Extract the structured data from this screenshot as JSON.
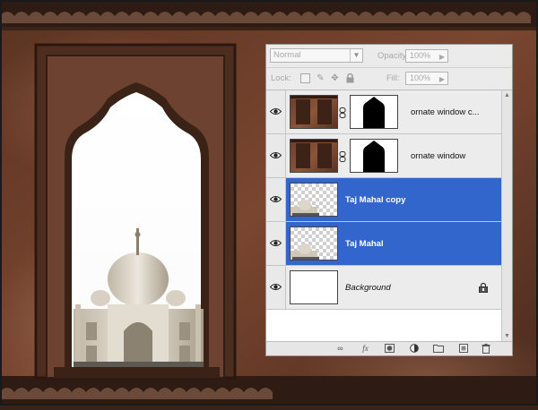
{
  "layers_panel": {
    "blend_mode": "Normal",
    "opacity_label": "Opacity:",
    "opacity_value": "100%",
    "lock_label": "Lock:",
    "fill_label": "Fill:",
    "fill_value": "100%",
    "layers": [
      {
        "name": "ornate window c...",
        "visible": true,
        "selected": false,
        "has_mask": true
      },
      {
        "name": "ornate window",
        "visible": true,
        "selected": false,
        "has_mask": true
      },
      {
        "name": "Taj Mahal copy",
        "visible": true,
        "selected": true,
        "has_mask": false
      },
      {
        "name": "Taj Mahal",
        "visible": true,
        "selected": true,
        "has_mask": false
      },
      {
        "name": "Background",
        "visible": true,
        "selected": false,
        "has_mask": false,
        "locked": true
      }
    ],
    "colors": {
      "selection": "#3366cc",
      "panel": "#ebebeb"
    }
  }
}
